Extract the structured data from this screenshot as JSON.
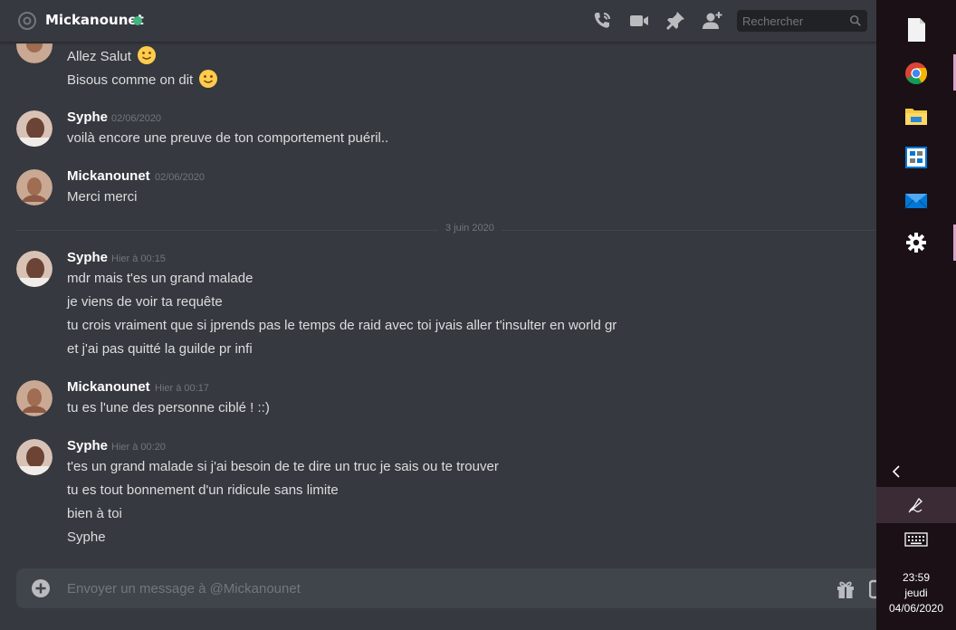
{
  "header": {
    "recipient": "Mickanounet",
    "search_placeholder": "Rechercher",
    "status_color": "#43b581"
  },
  "messages": {
    "partial_group": {
      "lines": [
        "Allez Salut",
        "Bisous comme on dit"
      ]
    },
    "groups": [
      {
        "author": "Syphe",
        "timestamp": "02/06/2020",
        "lines": [
          "voilà encore une preuve de ton comportement puéril.."
        ]
      },
      {
        "author": "Mickanounet",
        "timestamp": "02/06/2020",
        "lines": [
          "Merci merci"
        ]
      },
      {
        "author": "Syphe",
        "timestamp": "Hier à 00:15",
        "lines": [
          "mdr mais t'es un grand malade",
          "je viens de voir ta requête",
          "tu crois vraiment que si jprends pas le temps de raid avec toi jvais aller t'insulter en world gr",
          "et j'ai pas quitté la guilde pr infi"
        ]
      },
      {
        "author": "Mickanounet",
        "timestamp": "Hier à 00:17",
        "lines": [
          "tu es l'une des personne ciblé ! ::)"
        ]
      },
      {
        "author": "Syphe",
        "timestamp": "Hier à 00:20",
        "lines": [
          "t'es un grand malade si j'ai besoin de te dire un truc je sais ou te trouver",
          "tu es tout bonnement d'un ridicule sans limite",
          "bien à toi",
          "Syphe"
        ]
      }
    ],
    "date_divider": "3 juin 2020"
  },
  "composer": {
    "placeholder": "Envoyer un message à @Mickanounet"
  },
  "taskbar": {
    "apps": [
      "file-icon",
      "chrome-icon",
      "file-explorer-icon",
      "photo-app-icon",
      "mail-icon",
      "settings-icon"
    ],
    "clock": {
      "time": "23:59",
      "day": "jeudi",
      "date": "04/06/2020"
    }
  },
  "colors": {
    "background": "#36393f",
    "input": "#40444b",
    "taskbar": "#1a1016",
    "muted_text": "#72767d"
  }
}
